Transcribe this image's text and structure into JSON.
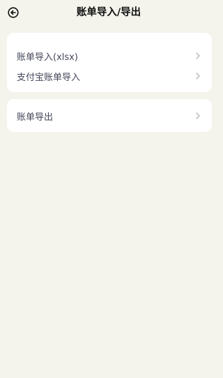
{
  "header": {
    "title": "账单导入/导出",
    "back_icon": "back-arrow-circle-icon"
  },
  "sections": [
    {
      "items": [
        {
          "label": "账单导入(xlsx)",
          "icon": "chevron-right-icon"
        },
        {
          "label": "支付宝账单导入",
          "icon": "chevron-right-icon"
        }
      ]
    },
    {
      "items": [
        {
          "label": "账单导出",
          "icon": "chevron-right-icon"
        }
      ]
    }
  ],
  "colors": {
    "background": "#f4f4ec",
    "card": "#ffffff",
    "label_text": "#44475a",
    "chevron": "#b8b8b8"
  }
}
